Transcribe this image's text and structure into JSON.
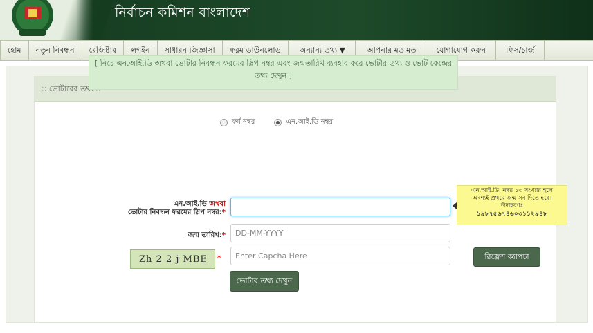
{
  "header": {
    "title": "নির্বাচন কমিশন বাংলাদেশ"
  },
  "nav": {
    "items": [
      "হোম",
      "নতুন নিবন্ধন",
      "রেজিষ্টার",
      "লগইন",
      "সাধারন জিজ্ঞাসা",
      "ফরম ডাউনলোড",
      "অন্যান্য তথ্য ▼",
      "আপনার মতামত",
      "যোগাযোগ করুন",
      "ফিস/চার্জ"
    ]
  },
  "panel": {
    "title": ":: ভোটারের তথ্য ::"
  },
  "notice": {
    "text": "[ নিচে এন.আই.ডি অথবা ভোটার নিবন্ধন ফরমের স্লিপ নম্বর এবং জন্মতারিখ ব্যবহার করে ভোটার তথ্য ও ভোট কেন্দ্রের তথ্য দেখুন ]"
  },
  "radios": {
    "form_number": "ফর্ম নম্বর",
    "nid_number": "এন.আই.ডি নম্বর"
  },
  "form": {
    "nid_label_part1": "এন.আই.ডি",
    "nid_label_or": "অথবা",
    "nid_label_part2": "ভোটার নিবন্ধন ফরমের স্লিপ নম্বর:",
    "dob_label": "জন্ম তারিখ:",
    "dob_placeholder": "DD-MM-YYYY",
    "captcha_placeholder": "Enter Capcha Here",
    "required_mark": "*"
  },
  "tooltip": {
    "line1": "এন.আই.ডি. নম্বর ১৩ সংখ্যার হলে",
    "line2": "অবশ্যই প্রথমে জন্ম সন দিতে হবে।",
    "line3": "উদাহরণঃ",
    "example": "১৯৮৭৫৬৭৪৬০৩১১২৯৪৮"
  },
  "captcha": {
    "text": "Zh 2 2 j MBE"
  },
  "buttons": {
    "refresh": "রিফ্রেশ ক্যাপচা",
    "submit": "ভোটার তথ্য দেখুন"
  }
}
